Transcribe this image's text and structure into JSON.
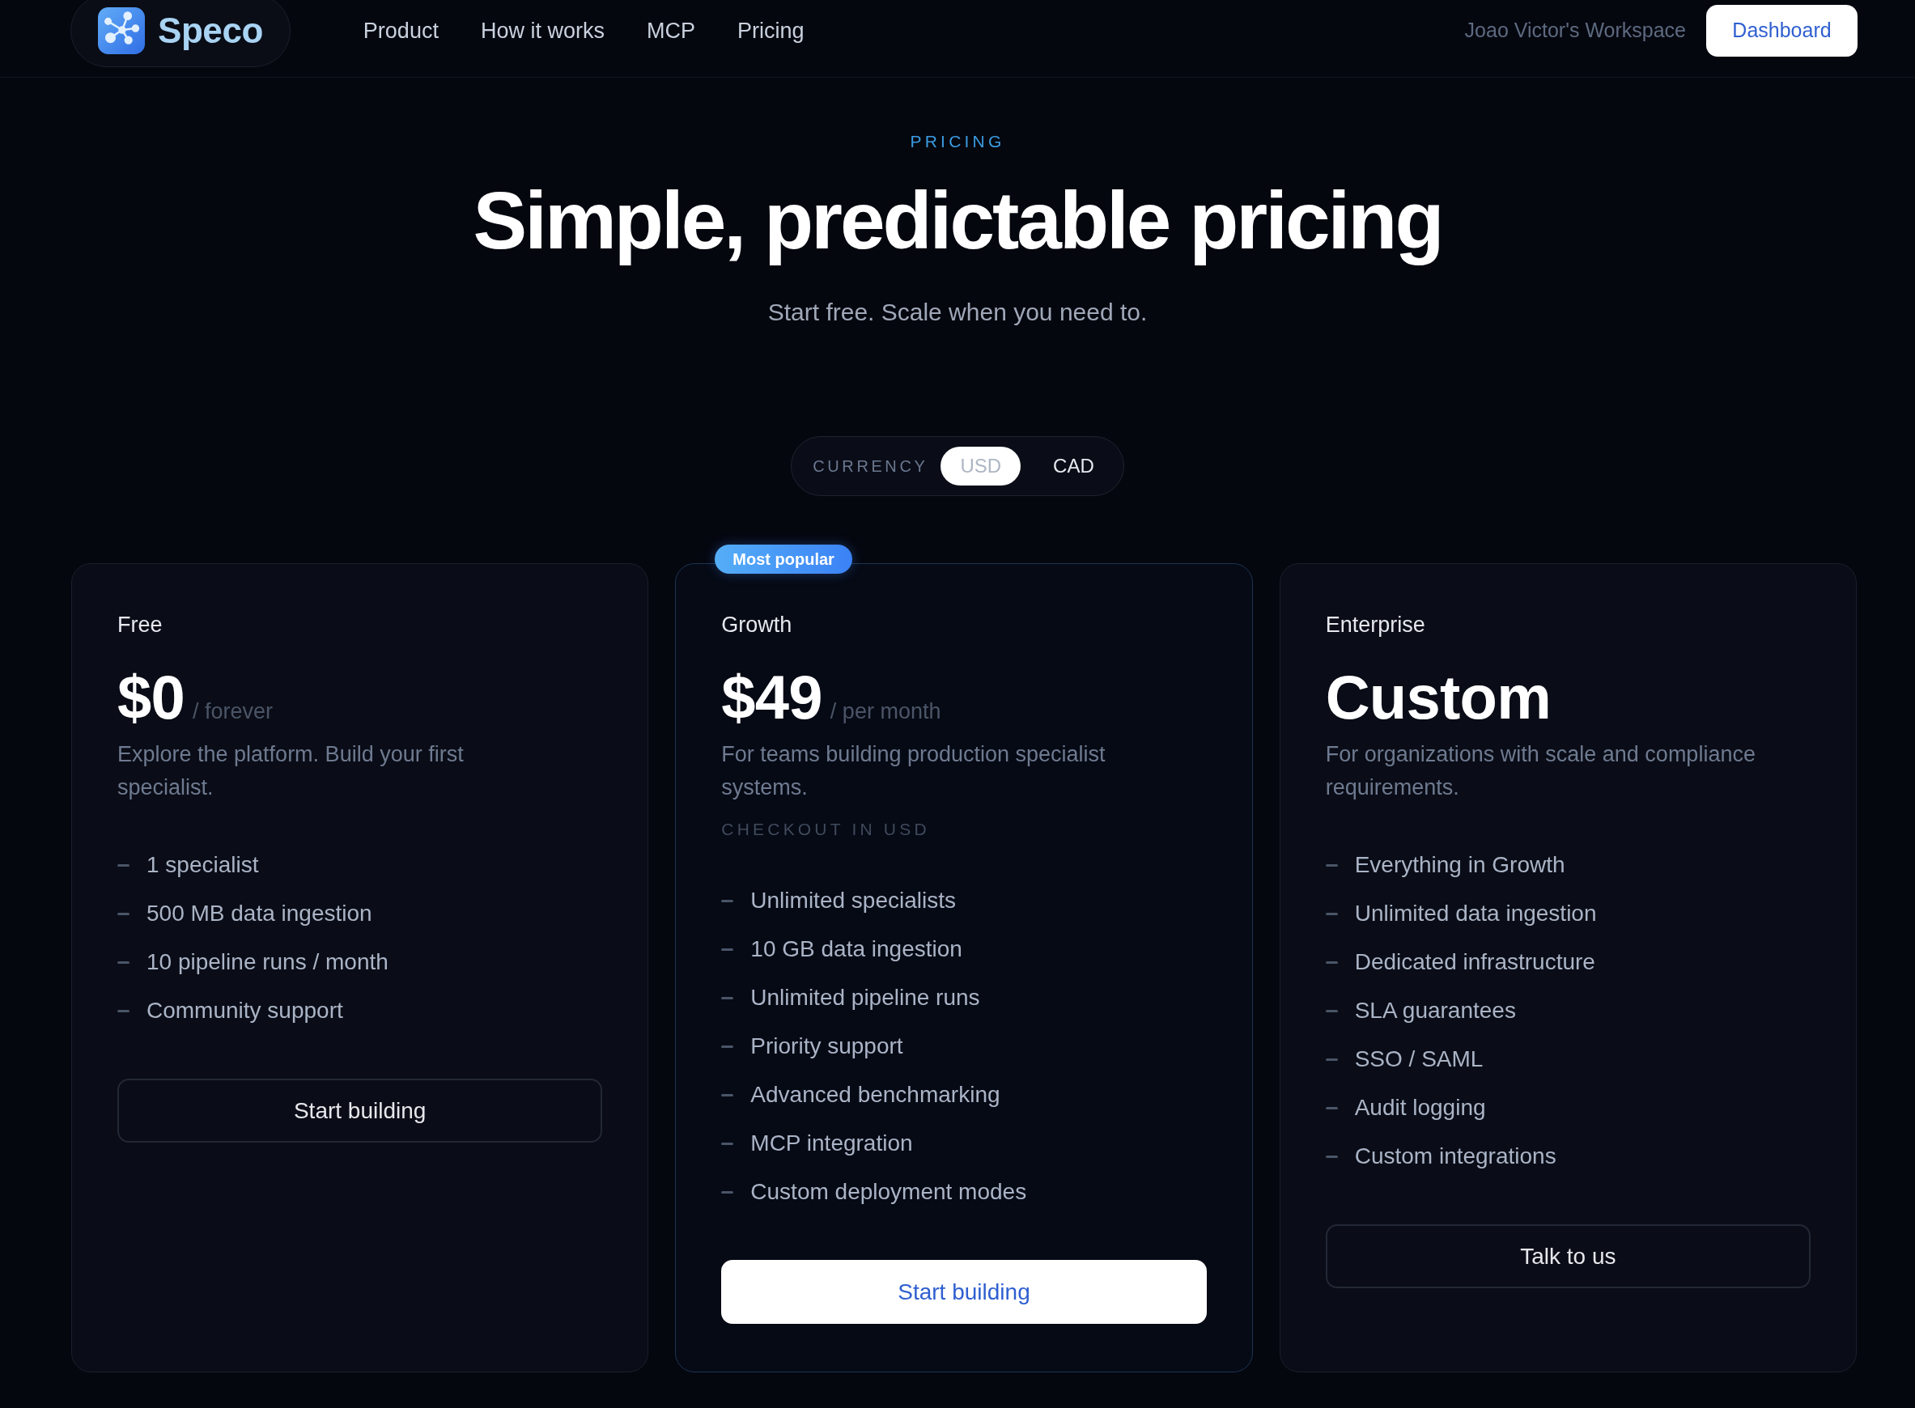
{
  "navbar": {
    "brand": "Speco",
    "links": [
      "Product",
      "How it works",
      "MCP",
      "Pricing"
    ],
    "workspace": "Joao Victor's Workspace",
    "button": "Dashboard"
  },
  "hero": {
    "eyebrow": "PRICING",
    "title": "Simple, predictable pricing",
    "subtitle": "Start free. Scale when you need to."
  },
  "currency": {
    "label": "CURRENCY",
    "options": [
      {
        "label": "USD",
        "selected": true
      },
      {
        "label": "CAD",
        "selected": false
      }
    ]
  },
  "plans": [
    {
      "name": "Free",
      "featured": false,
      "price": "$0",
      "period": "/ forever",
      "description": "Explore the platform. Build your first specialist.",
      "features": [
        "1 specialist",
        "500 MB data ingestion",
        "10 pipeline runs / month",
        "Community support"
      ],
      "button": "Start building"
    },
    {
      "badge": "Most popular",
      "name": "Growth",
      "featured": true,
      "price": "$49",
      "period": "/ per month",
      "description": "For teams building production specialist systems.",
      "note": "CHECKOUT IN USD",
      "features": [
        "Unlimited specialists",
        "10 GB data ingestion",
        "Unlimited pipeline runs",
        "Priority support",
        "Advanced benchmarking",
        "MCP integration",
        "Custom deployment modes"
      ],
      "button": "Start building"
    },
    {
      "name": "Enterprise",
      "featured": false,
      "price": "Custom",
      "description": "For organizations with scale and compliance requirements.",
      "features": [
        "Everything in Growth",
        "Unlimited data ingestion",
        "Dedicated infrastructure",
        "SLA guarantees",
        "SSO / SAML",
        "Audit logging",
        "Custom integrations"
      ],
      "button": "Talk to us"
    }
  ]
}
